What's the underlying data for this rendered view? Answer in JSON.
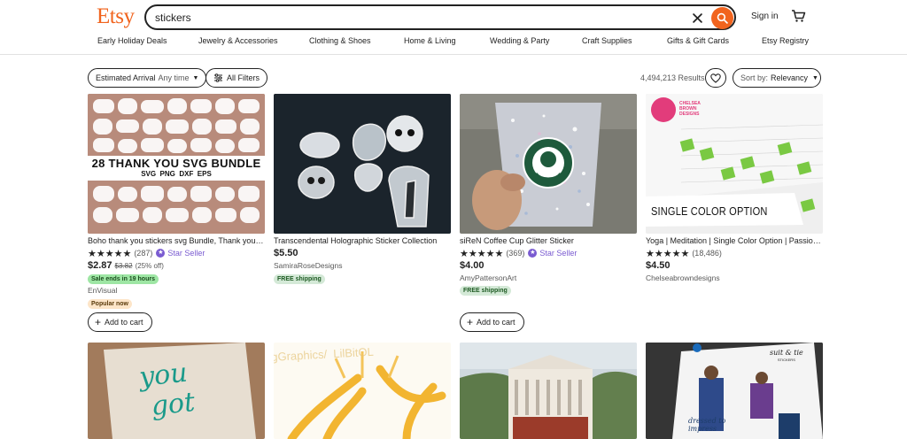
{
  "header": {
    "logo": "Etsy",
    "search_value": "stickers",
    "signin": "Sign in",
    "categories": [
      "Early Holiday Deals",
      "Jewelry & Accessories",
      "Clothing & Shoes",
      "Home & Living",
      "Wedding & Party",
      "Craft Supplies",
      "Gifts & Gift Cards",
      "Etsy Registry"
    ]
  },
  "filters": {
    "arrival_label": "Estimated Arrival",
    "arrival_value": "Any time",
    "all_filters": "All Filters",
    "results": "4,494,213 Results",
    "sort_label": "Sort by:",
    "sort_value": "Relevancy"
  },
  "listings": [
    {
      "title": "Boho thank you stickers svg Bundle, Thank you sticker svg, Thank you svg, Planner stickers",
      "stars": "★★★★★",
      "reviews": "(287)",
      "star_seller": "Star Seller",
      "price": "$2.87",
      "original_price": "$3.82",
      "discount": "(25% off)",
      "sale_badge": "Sale ends in 19 hours",
      "shop": "EnVisual",
      "popular_badge": "Popular now",
      "add_to_cart": "Add to cart",
      "image": {
        "banner": "28 THANK YOU SVG BUNDLE",
        "formats": "SVG  PNG  DXF  EPS"
      }
    },
    {
      "title": "Transcendental Holographic Sticker Collection",
      "price": "$5.50",
      "shop": "SamiraRoseDesigns",
      "shipping_badge": "FREE shipping"
    },
    {
      "title": "siReN Coffee Cup Glitter Sticker",
      "stars": "★★★★★",
      "reviews": "(369)",
      "star_seller": "Star Seller",
      "price": "$4.00",
      "shop": "AmyPattersonArt",
      "shipping_badge": "FREE shipping",
      "add_to_cart": "Add to cart"
    },
    {
      "title": "Yoga | Meditation | Single Color Option | Passion Planner Stickers",
      "stars": "★★★★★",
      "reviews": "(18,486)",
      "price": "$4.50",
      "shop": "Chelseabrowndesigns",
      "image": {
        "caption": "SINGLE COLOR OPTION",
        "brand_line1": "CHELSEA",
        "brand_line2": "BROWN",
        "brand_line3": "DESIGNS"
      }
    }
  ],
  "row2": {
    "card1_text_line1": "you",
    "card1_text_line2": "got",
    "card2_watermark": "ogGraphics/  LilBitOL",
    "card4_title_line1": "suit & tie",
    "card4_title_line2": "STICKERS",
    "card4_script": "dressed to impress"
  },
  "colors": {
    "brand": "#f1641e",
    "star_seller": "#7a5bd1",
    "sale_green": "#9ee6a4"
  }
}
